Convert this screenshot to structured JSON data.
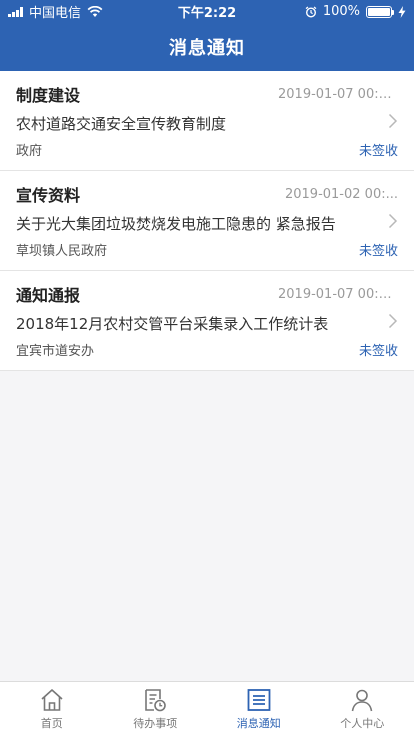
{
  "status_bar": {
    "carrier": "中国电信",
    "time": "下午2:22",
    "battery_percent": "100%",
    "battery_level": 1.0
  },
  "nav": {
    "title": "消息通知"
  },
  "messages": [
    {
      "category": "制度建设",
      "time": "2019-01-07 00:0...",
      "title": "农村道路交通安全宣传教育制度",
      "source": "政府",
      "status": "未签收"
    },
    {
      "category": "宣传资料",
      "time": "2019-01-02 00:...",
      "title": "关于光大集团垃圾焚烧发电施工隐患的 紧急报告",
      "source": "草坝镇人民政府",
      "status": "未签收"
    },
    {
      "category": "通知通报",
      "time": "2019-01-07 00:0...",
      "title": "2018年12月农村交管平台采集录入工作统计表",
      "source": "宜宾市道安办",
      "status": "未签收"
    }
  ],
  "tabbar": {
    "items": [
      {
        "label": "首页",
        "icon": "home-icon",
        "active": false
      },
      {
        "label": "待办事项",
        "icon": "todo-icon",
        "active": false
      },
      {
        "label": "消息通知",
        "icon": "message-icon",
        "active": true
      },
      {
        "label": "个人中心",
        "icon": "person-icon",
        "active": false
      }
    ]
  },
  "colors": {
    "primary": "#2d63b3",
    "background": "#f5f5f7",
    "inactive_tab": "#777777"
  }
}
